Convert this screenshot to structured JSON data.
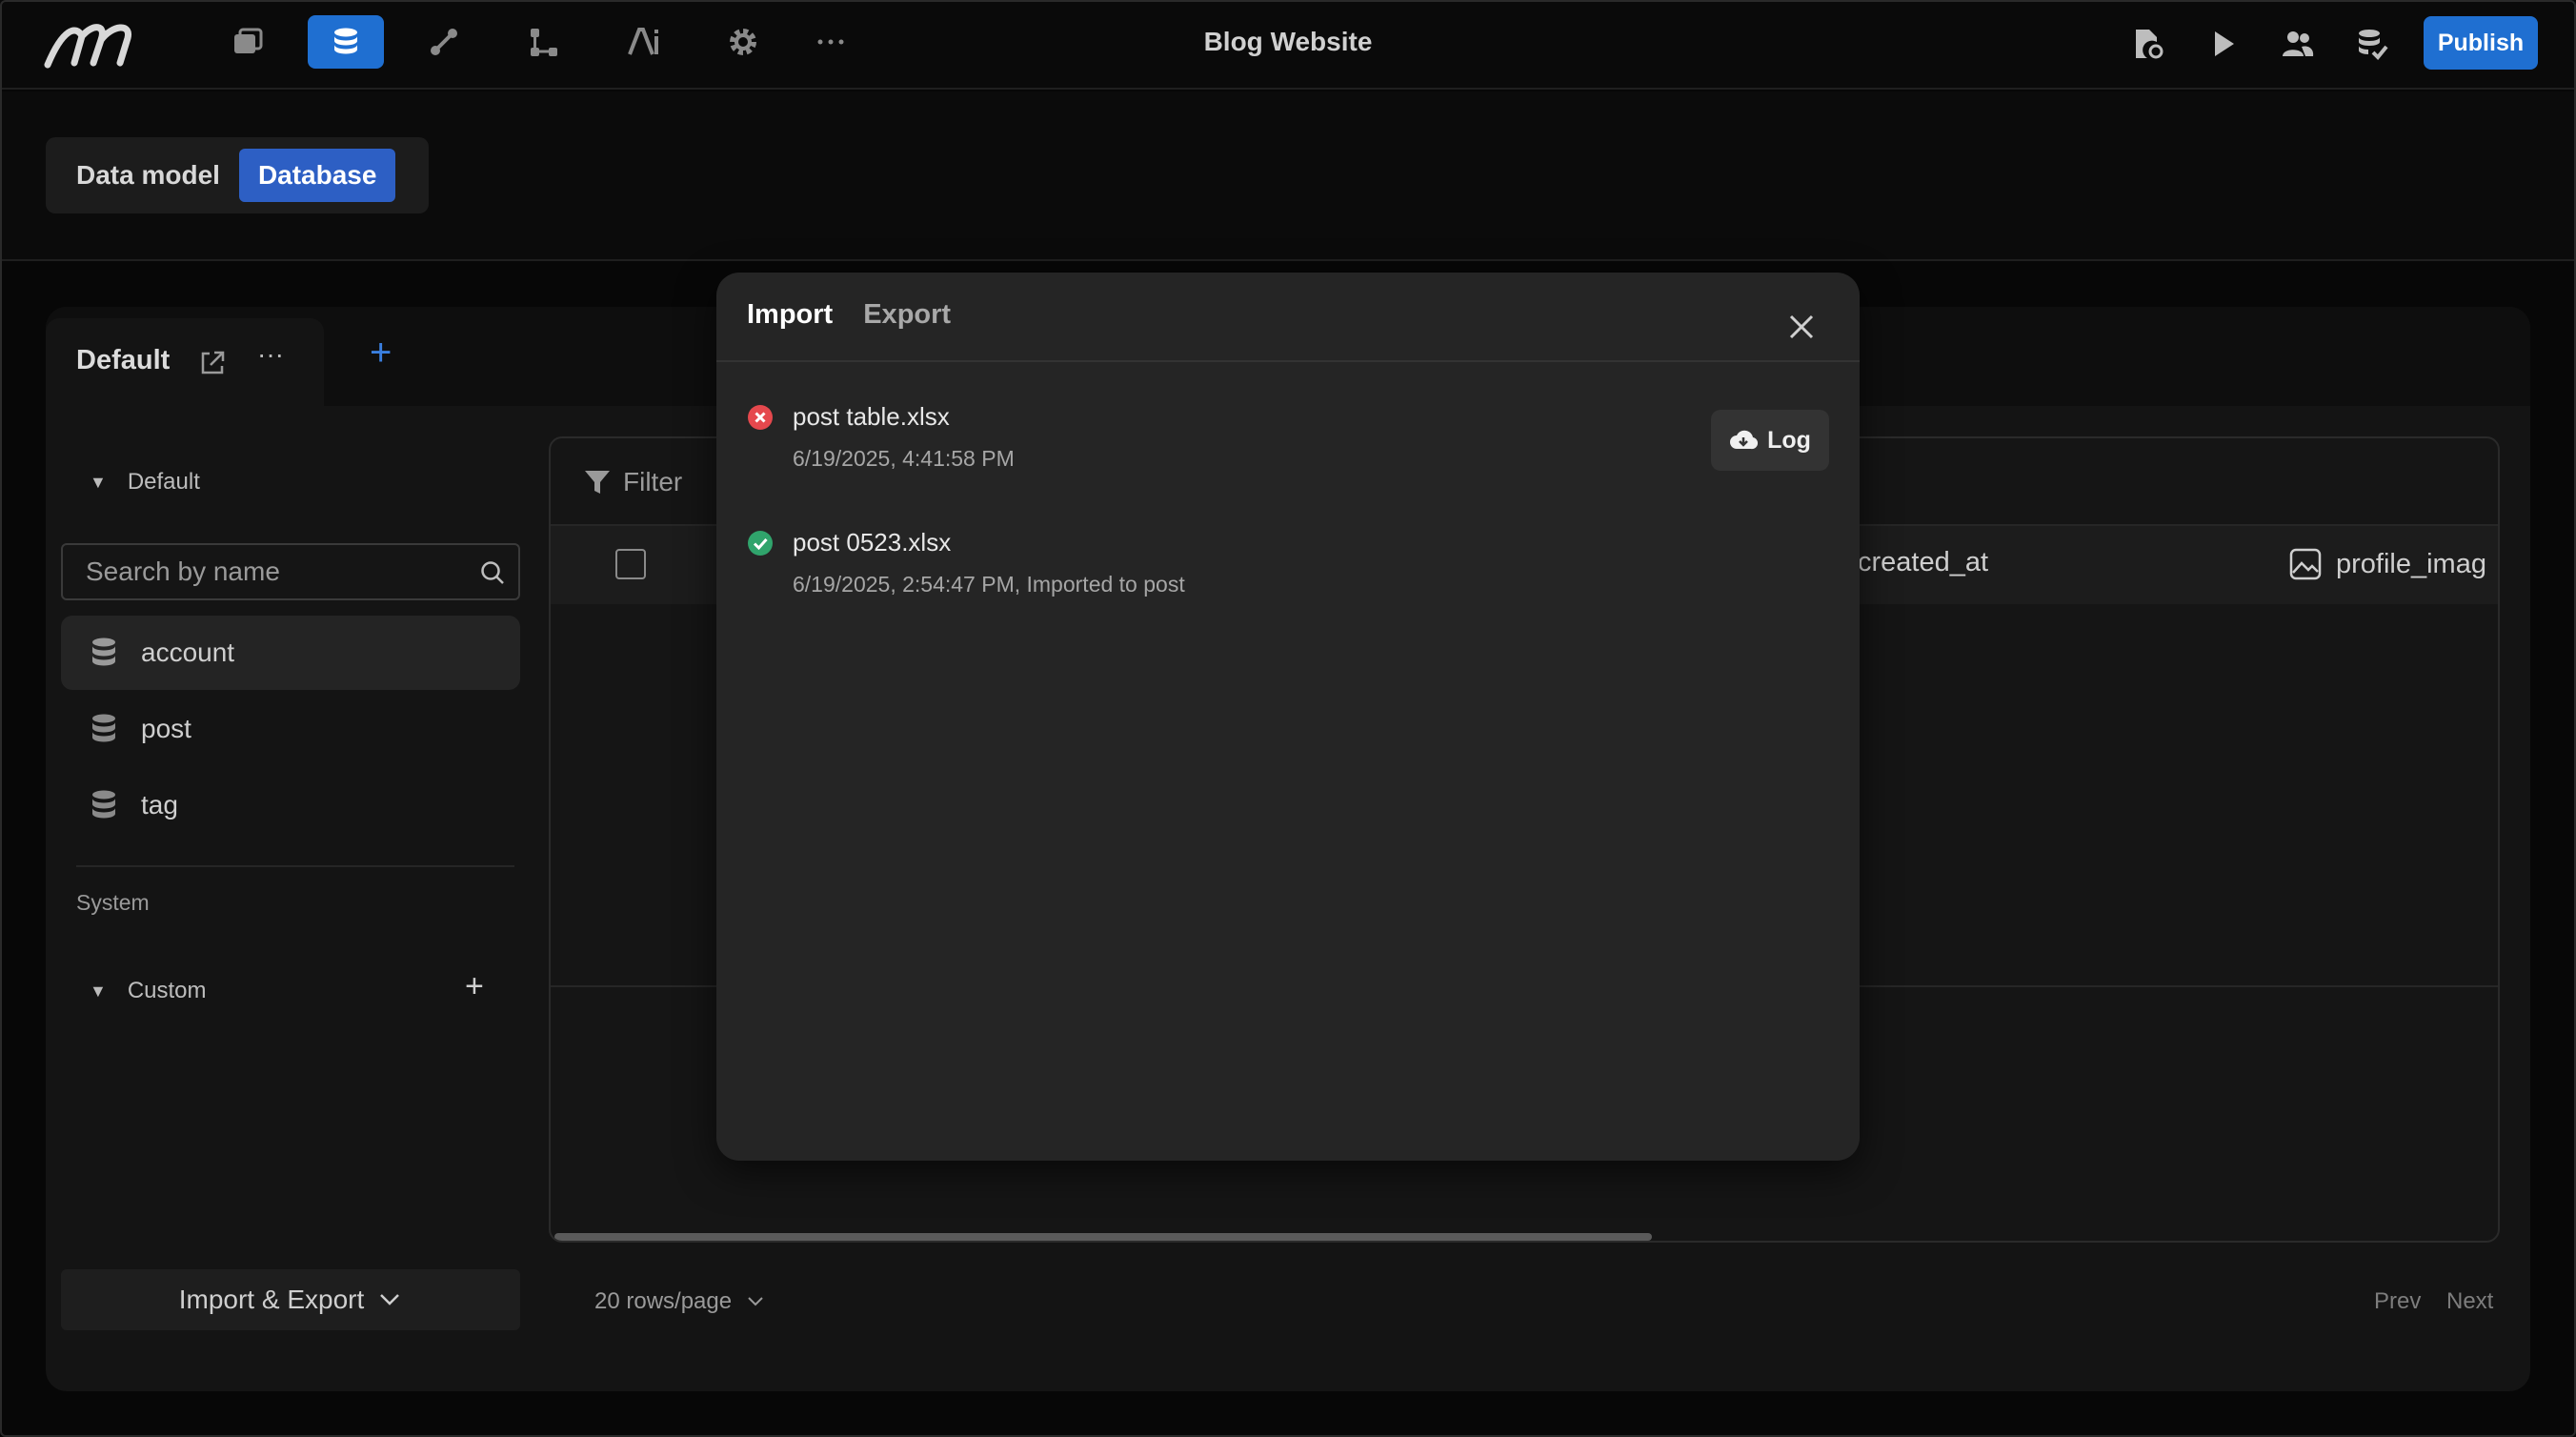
{
  "app": {
    "title": "Blog Website",
    "publish_label": "Publish"
  },
  "topbar": {
    "nav_icons": [
      "pages-icon",
      "database-icon",
      "workflow-icon",
      "flow-icon",
      "ai-icon",
      "settings-icon",
      "more-icon"
    ],
    "active_icon": "database-icon",
    "right_icons": [
      "file-settings-icon",
      "preview-play-icon",
      "users-icon",
      "db-check-icon"
    ],
    "accent": "#1f6fd1"
  },
  "subheader": {
    "data_model": "Data model",
    "database": "Database"
  },
  "tabs": {
    "default_label": "Default",
    "add": "+"
  },
  "sidebar": {
    "group_default": "Default",
    "search_placeholder": "Search by name",
    "tables": [
      {
        "label": "account",
        "selected": true
      },
      {
        "label": "post",
        "selected": false
      },
      {
        "label": "tag",
        "selected": false
      }
    ],
    "system_label": "System",
    "group_custom": "Custom",
    "import_export": "Import & Export"
  },
  "grid": {
    "filter": "Filter",
    "columns": [
      "created_at",
      "profile_imag"
    ],
    "rows_per_page": "20 rows/page",
    "prev": "Prev",
    "next": "Next"
  },
  "modal": {
    "tab_import": "Import",
    "tab_export": "Export",
    "imports": [
      {
        "file": "post table.xlsx",
        "meta": "6/19/2025, 4:41:58 PM",
        "status": "error"
      },
      {
        "file": "post 0523.xlsx",
        "meta": "6/19/2025, 2:54:47 PM, Imported to post",
        "status": "success"
      }
    ],
    "log_label": "Log",
    "colors": {
      "error": "#e5484d",
      "success": "#30a46c"
    }
  }
}
